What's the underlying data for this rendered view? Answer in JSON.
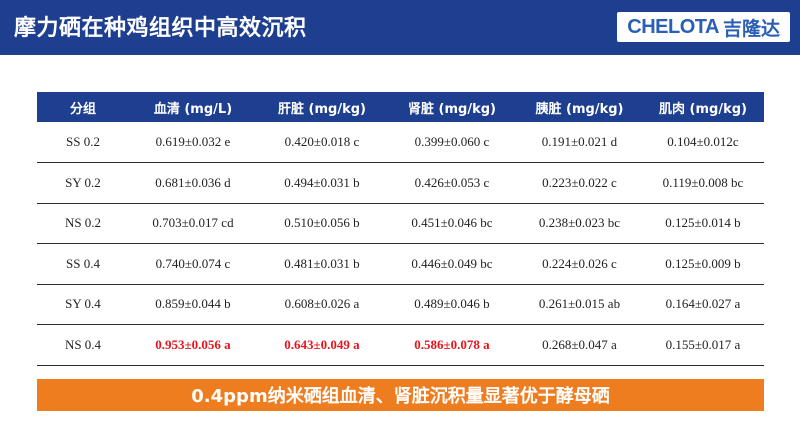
{
  "header": {
    "title": "摩力硒在种鸡组织中高效沉积",
    "brand_en": "CHELOTA",
    "brand_cn": "吉隆达"
  },
  "table": {
    "columns": [
      "分组",
      "血清 (mg/L)",
      "肝脏 (mg/kg)",
      "肾脏 (mg/kg)",
      "胰脏 (mg/kg)",
      "肌肉 (mg/kg)"
    ],
    "rows": [
      [
        "SS 0.2",
        "0.619±0.032 e",
        "0.420±0.018 c",
        "0.399±0.060 c",
        "0.191±0.021 d",
        "0.104±0.012c"
      ],
      [
        "SY 0.2",
        "0.681±0.036 d",
        "0.494±0.031 b",
        "0.426±0.053 c",
        "0.223±0.022 c",
        "0.119±0.008 bc"
      ],
      [
        "NS 0.2",
        "0.703±0.017 cd",
        "0.510±0.056 b",
        "0.451±0.046 bc",
        "0.238±0.023 bc",
        "0.125±0.014 b"
      ],
      [
        "SS 0.4",
        "0.740±0.074 c",
        "0.481±0.031 b",
        "0.446±0.049 bc",
        "0.224±0.026 c",
        "0.125±0.009 b"
      ],
      [
        "SY 0.4",
        "0.859±0.044 b",
        "0.608±0.026 a",
        "0.489±0.046 b",
        "0.261±0.015 ab",
        "0.164±0.027 a"
      ],
      [
        "NS 0.4",
        "0.953±0.056 a",
        "0.643±0.049 a",
        "0.586±0.078 a",
        "0.268±0.047 a",
        "0.155±0.017 a"
      ]
    ],
    "highlight_color": "#e8141c"
  },
  "banner": {
    "text": "0.4ppm纳米硒组血清、肾脏沉积量显著优于酵母硒"
  },
  "colors": {
    "header_blue": "#1e3f8f",
    "banner_orange": "#ee7d1f"
  }
}
